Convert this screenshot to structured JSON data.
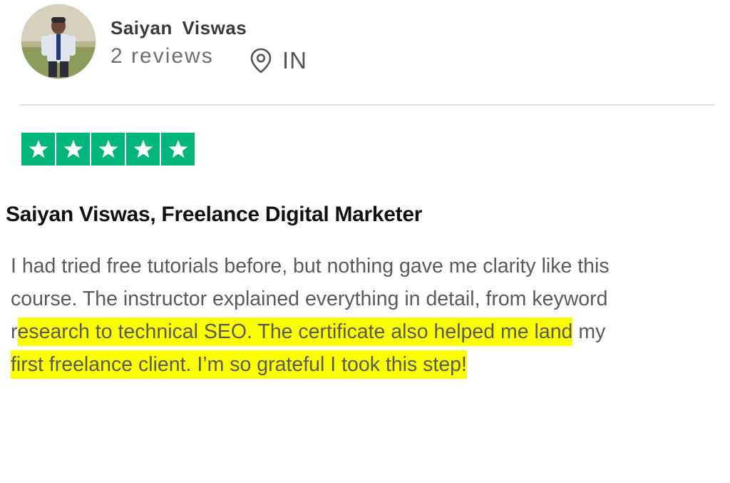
{
  "reviewer": {
    "name": "Saiyan  Viswas",
    "reviews": "2 reviews",
    "location_icon": "location-pin-icon",
    "country": "IN"
  },
  "rating": {
    "stars": 5,
    "max": 5,
    "star_color": "#00b67a",
    "icon": "star-icon"
  },
  "review": {
    "title": "Saiyan Viswas, Freelance Digital Marketer",
    "lines": [
      {
        "text": "I had tried free tutorials before, but nothing gave me clarity like this",
        "pre": "",
        "highlight": "",
        "post": ""
      },
      {
        "text": "course. The instructor explained everything in detail, from keyword",
        "pre": "",
        "highlight": "",
        "post": ""
      },
      {
        "pre": "r",
        "highlight": "esearch to technical SEO. The certificate also helped me land",
        "post": " my"
      },
      {
        "pre": "",
        "highlight": "first freelance client. I’m so grateful I took this step!",
        "post": ""
      }
    ],
    "highlight_color": "#fcff00"
  }
}
